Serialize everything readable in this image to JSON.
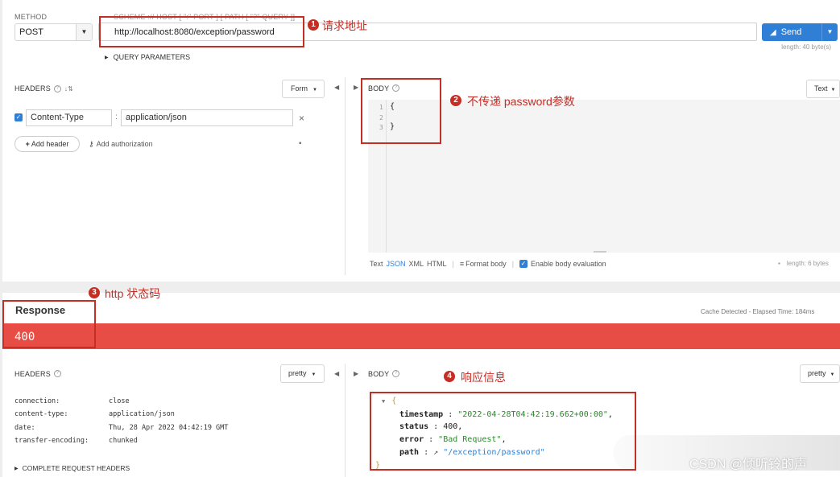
{
  "request": {
    "method_label": "METHOD",
    "method_value": "POST",
    "url_label": "SCHEME :// HOST [ \":\" PORT ] [ PATH [ \"?\" QUERY ]]",
    "url_value": "http://localhost:8080/exception/password",
    "send_label": "Send",
    "url_length": "length: 40 byte(s)",
    "query_params_label": "QUERY PARAMETERS"
  },
  "headers_panel": {
    "title": "HEADERS",
    "mode": "Form",
    "header_name": "Content-Type",
    "header_value": "application/json",
    "add_header": "Add header",
    "add_authorization": "Add authorization"
  },
  "body_panel": {
    "title": "BODY",
    "mode": "Text",
    "lines": [
      "1",
      "2",
      "3"
    ],
    "code": [
      "{",
      "",
      "}"
    ],
    "formats": [
      "Text",
      "JSON",
      "XML",
      "HTML"
    ],
    "format_body": "Format body",
    "enable_eval": "Enable body evaluation",
    "length": "length: 6 bytes"
  },
  "response": {
    "title": "Response",
    "meta": "Cache Detected - Elapsed Time: 184ms",
    "status": "400",
    "status_color": "#e74c45",
    "headers_title": "HEADERS",
    "headers_mode": "pretty",
    "headers": [
      {
        "name": "connection:",
        "value": "close"
      },
      {
        "name": "content-type:",
        "value": "application/json"
      },
      {
        "name": "date:",
        "value": "Thu, 28 Apr 2022 04:42:19 GMT"
      },
      {
        "name": "transfer-encoding:",
        "value": "chunked"
      }
    ],
    "complete_headers": "COMPLETE REQUEST HEADERS",
    "body_title": "BODY",
    "body_mode": "pretty",
    "json": {
      "open": "{",
      "timestamp_key": "timestamp",
      "timestamp_val": "\"2022-04-28T04:42:19.662+00:00\"",
      "status_key": "status",
      "status_val": "400",
      "error_key": "error",
      "error_val": "\"Bad Request\"",
      "path_key": "path",
      "path_val": "\"/exception/password\"",
      "close": "}"
    }
  },
  "annotations": {
    "m1": "1",
    "n1": "请求地址",
    "m2": "2",
    "n2": "不传递 password参数",
    "m3": "3",
    "n3": "http 状态码",
    "m4": "4",
    "n4": "响应信息"
  },
  "watermark": "CSDN @倾听铃的声"
}
